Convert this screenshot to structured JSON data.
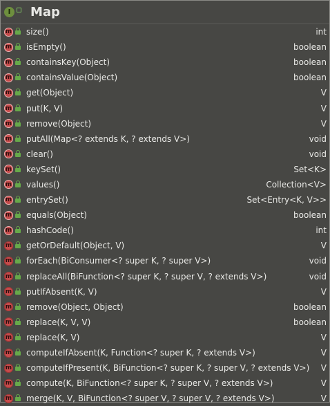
{
  "header": {
    "title": "Map",
    "icon": "interface-icon"
  },
  "methods": [
    {
      "sig": "size()",
      "ret": "int",
      "abstract": true
    },
    {
      "sig": "isEmpty()",
      "ret": "boolean",
      "abstract": true
    },
    {
      "sig": "containsKey(Object)",
      "ret": "boolean",
      "abstract": true
    },
    {
      "sig": "containsValue(Object)",
      "ret": "boolean",
      "abstract": true
    },
    {
      "sig": "get(Object)",
      "ret": "V",
      "abstract": true
    },
    {
      "sig": "put(K, V)",
      "ret": "V",
      "abstract": true
    },
    {
      "sig": "remove(Object)",
      "ret": "V",
      "abstract": true
    },
    {
      "sig": "putAll(Map<? extends K, ? extends V>)",
      "ret": "void",
      "abstract": true
    },
    {
      "sig": "clear()",
      "ret": "void",
      "abstract": true
    },
    {
      "sig": "keySet()",
      "ret": "Set<K>",
      "abstract": true
    },
    {
      "sig": "values()",
      "ret": "Collection<V>",
      "abstract": true
    },
    {
      "sig": "entrySet()",
      "ret": "Set<Entry<K, V>>",
      "abstract": true
    },
    {
      "sig": "equals(Object)",
      "ret": "boolean",
      "abstract": true
    },
    {
      "sig": "hashCode()",
      "ret": "int",
      "abstract": true
    },
    {
      "sig": "getOrDefault(Object, V)",
      "ret": "V",
      "abstract": false
    },
    {
      "sig": "forEach(BiConsumer<? super K, ? super V>)",
      "ret": "void",
      "abstract": false
    },
    {
      "sig": "replaceAll(BiFunction<? super K, ? super V, ? extends V>)",
      "ret": "void",
      "abstract": false
    },
    {
      "sig": "putIfAbsent(K, V)",
      "ret": "V",
      "abstract": false
    },
    {
      "sig": "remove(Object, Object)",
      "ret": "boolean",
      "abstract": false
    },
    {
      "sig": "replace(K, V, V)",
      "ret": "boolean",
      "abstract": false
    },
    {
      "sig": "replace(K, V)",
      "ret": "V",
      "abstract": false
    },
    {
      "sig": "computeIfAbsent(K, Function<? super K, ? extends V>)",
      "ret": "V",
      "abstract": false
    },
    {
      "sig": "computeIfPresent(K, BiFunction<? super K, ? super V, ? extends V>)",
      "ret": "V",
      "abstract": false
    },
    {
      "sig": "compute(K, BiFunction<? super K, ? super V, ? extends V>)",
      "ret": "V",
      "abstract": false
    },
    {
      "sig": "merge(K, V, BiFunction<? super V, ? super V, ? extends V>)",
      "ret": "V",
      "abstract": false
    }
  ]
}
